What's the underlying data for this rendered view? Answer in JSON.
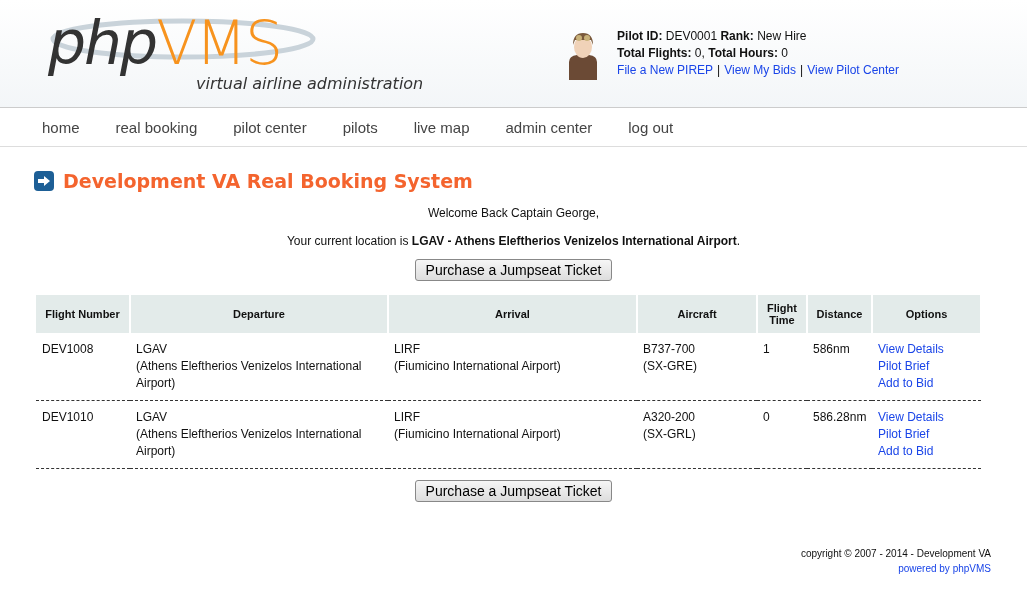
{
  "logo": {
    "part_1": "php",
    "part_2": "VMS",
    "tagline": "virtual airline administration"
  },
  "pilot": {
    "line_1": "**Pilot ID:** DEV0001 **Rank:** New Hire",
    "line_2": "**Total Flights:** 0, **Total Hours:** 0",
    "links": [
      "File a New PIREP",
      "View My Bids",
      "View Pilot Center"
    ],
    "separator": "|"
  },
  "nav": [
    "home",
    "real booking",
    "pilot center",
    "pilots",
    "live map",
    "admin center",
    "log out"
  ],
  "page_title": "Development VA Real Booking System",
  "welcome": "Welcome Back Captain George,",
  "location": "Your current location is **LGAV - Athens Eleftherios Venizelos International Airport**.",
  "purchase_button": "Purchase a Jumpseat Ticket",
  "table": {
    "columns": [
      "Flight Number",
      "Departure",
      "Arrival",
      "Aircraft",
      "Flight Time",
      "Distance",
      "Options"
    ],
    "rows": [
      {
        "flight": "DEV1008",
        "departure": [
          "LGAV",
          "(Athens Eleftherios Venizelos International Airport)"
        ],
        "arrival": [
          "LIRF",
          "(Fiumicino International Airport)"
        ],
        "aircraft": [
          "B737-700",
          "(SX-GRE)"
        ],
        "time": "1",
        "distance": "586nm",
        "options": [
          "View Details",
          "Pilot Brief",
          "Add to Bid"
        ]
      },
      {
        "flight": "DEV1010",
        "departure": [
          "LGAV",
          "(Athens Eleftherios Venizelos International Airport)"
        ],
        "arrival": [
          "LIRF",
          "(Fiumicino International Airport)"
        ],
        "aircraft": [
          "A320-200",
          "(SX-GRL)"
        ],
        "time": "0",
        "distance": "586.28nm",
        "options": [
          "View Details",
          "Pilot Brief",
          "Add to Bid"
        ]
      }
    ]
  },
  "purchase_button_bottom": "Purchase a Jumpseat Ticket",
  "footer": {
    "copyright": "copyright © 2007 - 2014 - Development VA",
    "powered": "powered by phpVMS"
  }
}
